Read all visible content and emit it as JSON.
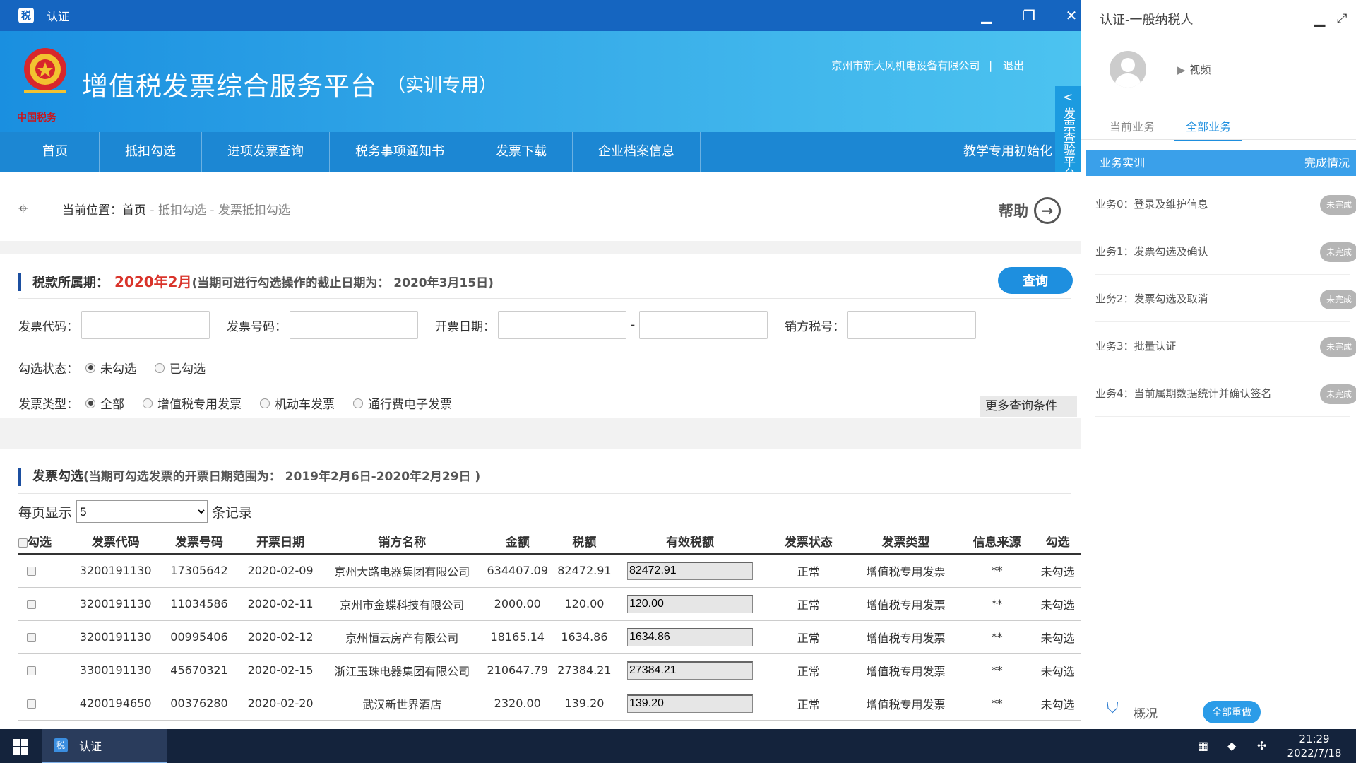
{
  "window": {
    "title": "认证",
    "app_icon": "税"
  },
  "banner": {
    "title": "增值税发票综合服务平台",
    "subtitle": "（实训专用）",
    "company": "京州市新大风机电设备有限公司",
    "separator": "|",
    "logout": "退出",
    "emblem_text": "中国税务"
  },
  "nav": {
    "items": [
      "首页",
      "抵扣勾选",
      "进项发票查询",
      "税务事项通知书",
      "发票下载",
      "企业档案信息"
    ],
    "right": "教学专用初始化"
  },
  "side_tab": {
    "arrow": "<",
    "label": "发票查验平台"
  },
  "breadcrumb": {
    "prefix": "当前位置：",
    "home": "首页",
    "sep": " - ",
    "level1": "抵扣勾选",
    "level2": "发票抵扣勾选",
    "help": "帮助"
  },
  "query": {
    "period_label": "税款所属期：",
    "period_value": "2020年2月",
    "deadline_note": "(当期可进行勾选操作的截止日期为：  2020年3月15日)",
    "query_button": "查询",
    "fields": {
      "code": "发票代码：",
      "number": "发票号码：",
      "date": "开票日期：",
      "date_sep": "-",
      "seller_tax": "销方税号："
    },
    "status_label": "勾选状态：",
    "status_options": [
      "未勾选",
      "已勾选"
    ],
    "type_label": "发票类型：",
    "type_options": [
      "全部",
      "增值税专用发票",
      "机动车发票",
      "通行费电子发票"
    ],
    "more": "更多查询条件"
  },
  "selection": {
    "title": "发票勾选",
    "range_note": "(当期可勾选发票的开票日期范围为：  2019年2月6日-2020年2月29日 )",
    "per_page_label": "每页显示",
    "per_page_value": "5",
    "per_page_suffix": "条记录",
    "columns": [
      "勾选",
      "发票代码",
      "发票号码",
      "开票日期",
      "销方名称",
      "金额",
      "税额",
      "有效税额",
      "发票状态",
      "发票类型",
      "信息来源",
      "勾选"
    ],
    "rows": [
      {
        "code": "3200191130",
        "number": "17305642",
        "date": "2020-02-09",
        "seller": "京州大路电器集团有限公司",
        "amount": "634407.09",
        "tax": "82472.91",
        "valid_tax": "82472.91",
        "status": "正常",
        "type": "增值税专用发票",
        "source": "**",
        "checked": "未勾选"
      },
      {
        "code": "3200191130",
        "number": "11034586",
        "date": "2020-02-11",
        "seller": "京州市金蝶科技有限公司",
        "amount": "2000.00",
        "tax": "120.00",
        "valid_tax": "120.00",
        "status": "正常",
        "type": "增值税专用发票",
        "source": "**",
        "checked": "未勾选"
      },
      {
        "code": "3200191130",
        "number": "00995406",
        "date": "2020-02-12",
        "seller": "京州恒云房产有限公司",
        "amount": "18165.14",
        "tax": "1634.86",
        "valid_tax": "1634.86",
        "status": "正常",
        "type": "增值税专用发票",
        "source": "**",
        "checked": "未勾选"
      },
      {
        "code": "3300191130",
        "number": "45670321",
        "date": "2020-02-15",
        "seller": "浙江玉珠电器集团有限公司",
        "amount": "210647.79",
        "tax": "27384.21",
        "valid_tax": "27384.21",
        "status": "正常",
        "type": "增值税专用发票",
        "source": "**",
        "checked": "未勾选"
      },
      {
        "code": "4200194650",
        "number": "00376280",
        "date": "2020-02-20",
        "seller": "武汉新世界酒店",
        "amount": "2320.00",
        "tax": "139.20",
        "valid_tax": "139.20",
        "status": "正常",
        "type": "增值税专用发票",
        "source": "**",
        "checked": "未勾选"
      }
    ]
  },
  "right_panel": {
    "title": "认证-一般纳税人",
    "video": "视频",
    "tabs": [
      "当前业务",
      "全部业务"
    ],
    "active_tab": "全部业务",
    "head_left": "业务实训",
    "head_right": "完成情况",
    "tasks": [
      {
        "name": "业务0：登录及维护信息",
        "status": "未完成"
      },
      {
        "name": "业务1：发票勾选及确认",
        "status": "未完成"
      },
      {
        "name": "业务2：发票勾选及取消",
        "status": "未完成"
      },
      {
        "name": "业务3：批量认证",
        "status": "未完成"
      },
      {
        "name": "业务4：当前属期数据统计并确认签名",
        "status": "未完成"
      }
    ],
    "overview": "概况",
    "redo": "全部重做"
  },
  "taskbar": {
    "app_label": "认证",
    "time": "21:29",
    "date": "2022/7/18"
  },
  "colors": {
    "accent": "#1e8fdf",
    "nav": "#1c87d3",
    "title_bar": "#1565c0",
    "period_red": "#d9342b",
    "badge_gray": "#b5b5b5"
  }
}
